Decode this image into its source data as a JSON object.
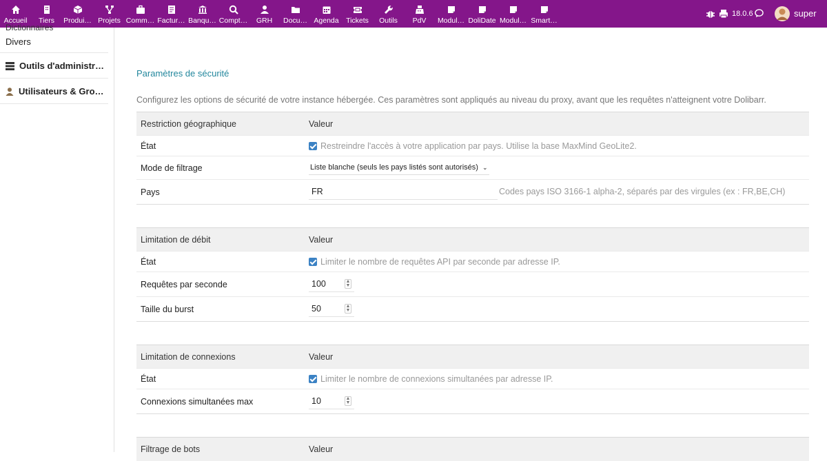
{
  "menu": [
    {
      "label": "Accueil",
      "icon": "home-icon"
    },
    {
      "label": "Tiers",
      "icon": "building-icon"
    },
    {
      "label": "Produi…",
      "icon": "cube-icon"
    },
    {
      "label": "Projets",
      "icon": "project-icon"
    },
    {
      "label": "Comm…",
      "icon": "briefcase-icon"
    },
    {
      "label": "Factur…",
      "icon": "invoice-icon"
    },
    {
      "label": "Banqu…",
      "icon": "bank-icon"
    },
    {
      "label": "Compt…",
      "icon": "search-icon"
    },
    {
      "label": "GRH",
      "icon": "user-icon"
    },
    {
      "label": "Docu…",
      "icon": "folder-icon"
    },
    {
      "label": "Agenda",
      "icon": "calendar-icon"
    },
    {
      "label": "Tickets",
      "icon": "ticket-icon"
    },
    {
      "label": "Outils",
      "icon": "wrench-icon"
    },
    {
      "label": "PdV",
      "icon": "cash-register-icon"
    },
    {
      "label": "Modul…",
      "icon": "note-icon"
    },
    {
      "label": "DoliDate",
      "icon": "note-icon"
    },
    {
      "label": "Modul…",
      "icon": "note-icon"
    },
    {
      "label": "Smart…",
      "icon": "note-icon"
    }
  ],
  "topright": {
    "version": "18.0.6",
    "user": "super"
  },
  "sidebar": {
    "clipped_label": "Dictionnaires",
    "divers": "Divers",
    "admin_tools": "Outils d'administrati…",
    "users_groups": "Utilisateurs & Group…"
  },
  "page": {
    "title": "Paramètres de sécurité",
    "intro": "Configurez les options de sécurité de votre instance hébergée. Ces paramètres sont appliqués au niveau du proxy, avant que les requêtes n'atteignent votre Dolibarr."
  },
  "geo": {
    "header": "Restriction géographique",
    "value_header": "Valeur",
    "state_label": "État",
    "state_text": "Restreindre l'accès à votre application par pays. Utilise la base MaxMind GeoLite2.",
    "state_checked": true,
    "mode_label": "Mode de filtrage",
    "mode_value": "Liste blanche (seuls les pays listés sont autorisés)",
    "country_label": "Pays",
    "country_value": "FR",
    "country_hint": "Codes pays ISO 3166-1 alpha-2, séparés par des virgules (ex : FR,BE,CH)"
  },
  "rate": {
    "header": "Limitation de débit",
    "value_header": "Valeur",
    "state_label": "État",
    "state_text": "Limiter le nombre de requêtes API par seconde par adresse IP.",
    "state_checked": true,
    "rps_label": "Requêtes par seconde",
    "rps_value": "100",
    "burst_label": "Taille du burst",
    "burst_value": "50"
  },
  "conn": {
    "header": "Limitation de connexions",
    "value_header": "Valeur",
    "state_label": "État",
    "state_text": "Limiter le nombre de connexions simultanées par adresse IP.",
    "state_checked": true,
    "max_label": "Connexions simultanées max",
    "max_value": "10"
  },
  "bots": {
    "header": "Filtrage de bots",
    "value_header": "Valeur"
  }
}
